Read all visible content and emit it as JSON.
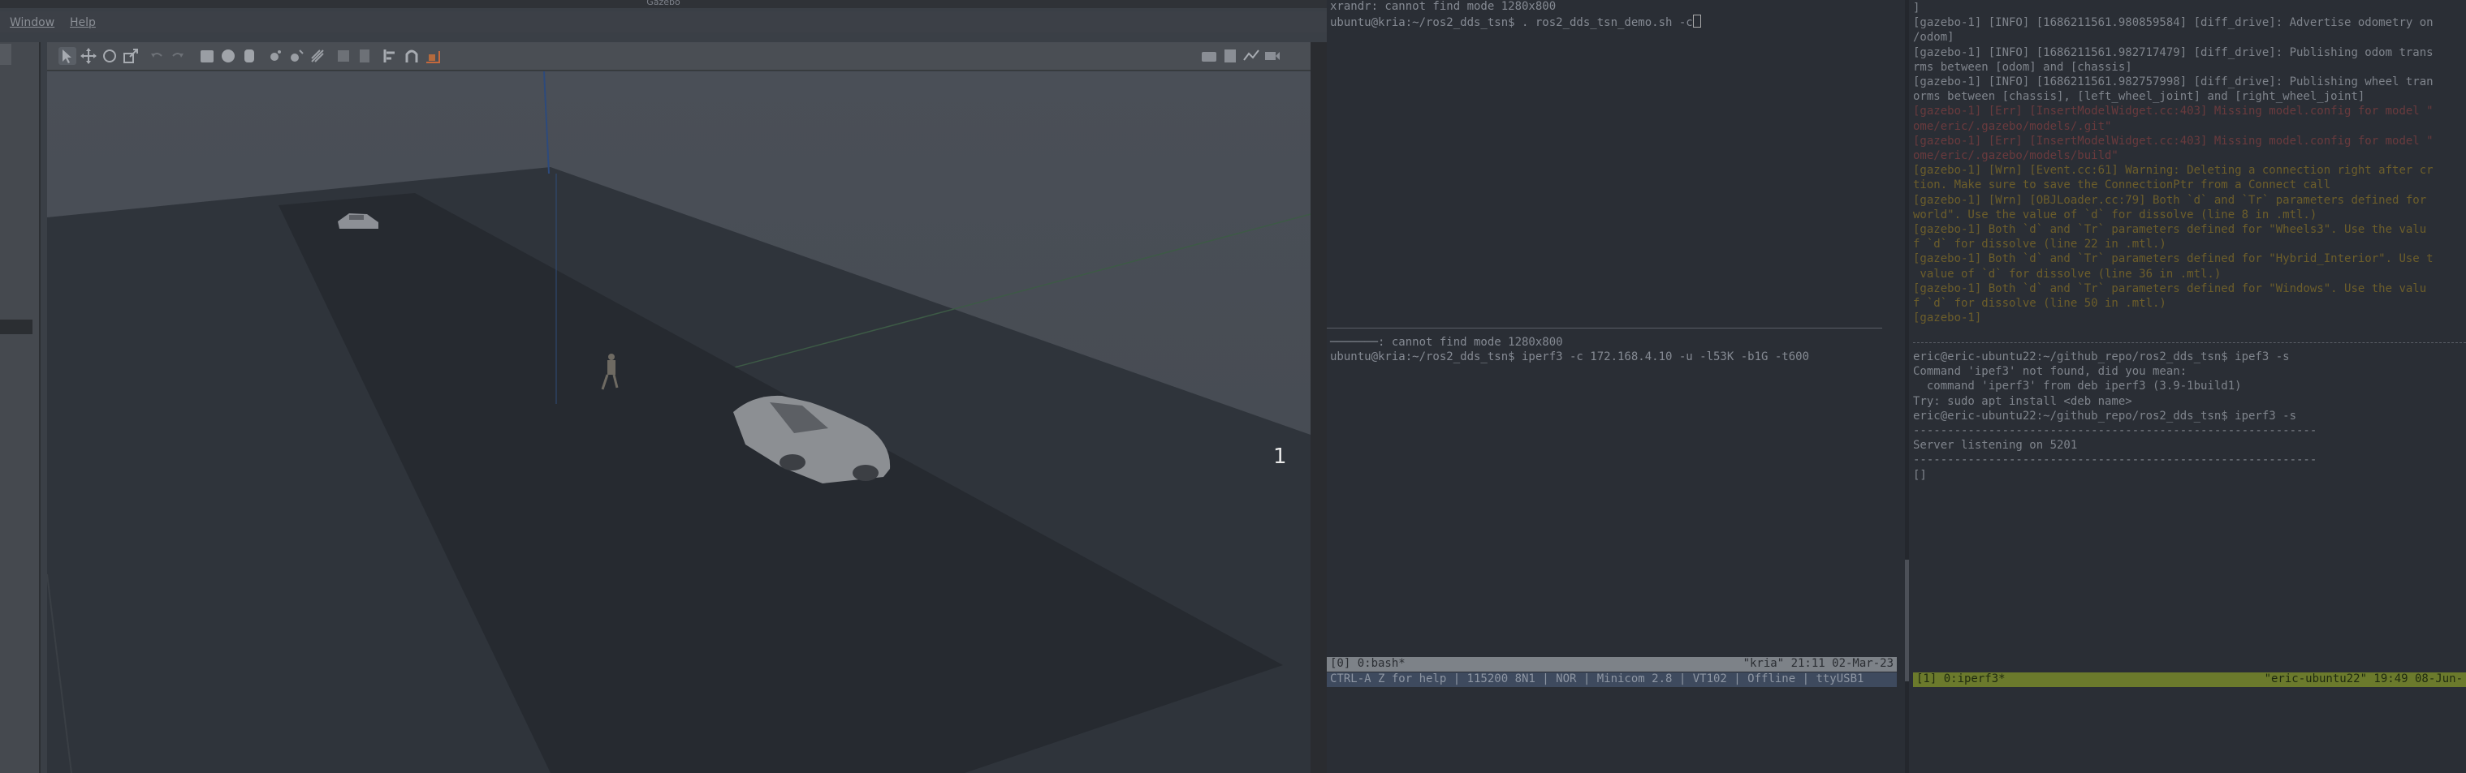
{
  "gazebo": {
    "title": "Gazebo",
    "menu": [
      "Window",
      "Help"
    ],
    "toolbar_icons": [
      "select-icon",
      "translate-icon",
      "rotate-icon",
      "scale-icon",
      "undo-icon",
      "redo-icon",
      "box-icon",
      "sphere-icon",
      "cylinder-icon",
      "point-light-icon",
      "spot-light-icon",
      "directional-light-icon",
      "copy-icon",
      "paste-icon",
      "align-icon",
      "snap-icon",
      "change-view-icon"
    ],
    "toolbar_right_icons": [
      "screenshot-icon",
      "log-icon",
      "plot-icon",
      "video-icon"
    ],
    "viewport_label": "1"
  },
  "term_mid": {
    "lines": [
      "xrandr: cannot find mode 1280x800",
      "ubuntu@kria:~/ros2_dds_tsn$ . ros2_dds_tsn_demo.sh -c"
    ],
    "lines_lower": [
      "───────: cannot find mode 1280x800",
      "ubuntu@kria:~/ros2_dds_tsn$ iperf3 -c 172.168.4.10 -u -l53K -b1G -t600"
    ],
    "status_left": "[0] 0:bash*",
    "status_right": "\"kria\" 21:11 02-Mar-23",
    "minicom_status": "CTRL-A Z for help | 115200 8N1 | NOR | Minicom 2.8 | VT102 | Offline | ttyUSB1"
  },
  "term_right": {
    "log_lines": [
      {
        "text": "]",
        "kind": "info"
      },
      {
        "text": "[gazebo-1] [INFO] [1686211561.980859584] [diff_drive]: Advertise odometry on",
        "kind": "info"
      },
      {
        "text": "/odom]",
        "kind": "info"
      },
      {
        "text": "[gazebo-1] [INFO] [1686211561.982717479] [diff_drive]: Publishing odom trans",
        "kind": "info"
      },
      {
        "text": "rms between [odom] and [chassis]",
        "kind": "info"
      },
      {
        "text": "[gazebo-1] [INFO] [1686211561.982757998] [diff_drive]: Publishing wheel tran",
        "kind": "info"
      },
      {
        "text": "orms between [chassis], [left_wheel_joint] and [right_wheel_joint]",
        "kind": "info"
      },
      {
        "text": "[gazebo-1] [Err] [InsertModelWidget.cc:403] Missing model.config for model \"",
        "kind": "err"
      },
      {
        "text": "ome/eric/.gazebo/models/.git\"",
        "kind": "err"
      },
      {
        "text": "[gazebo-1] [Err] [InsertModelWidget.cc:403] Missing model.config for model \"",
        "kind": "err"
      },
      {
        "text": "ome/eric/.gazebo/models/build\"",
        "kind": "err"
      },
      {
        "text": "[gazebo-1] [Wrn] [Event.cc:61] Warning: Deleting a connection right after cr",
        "kind": "warn"
      },
      {
        "text": "tion. Make sure to save the ConnectionPtr from a Connect call",
        "kind": "warn"
      },
      {
        "text": "[gazebo-1] [Wrn] [OBJLoader.cc:79] Both `d` and `Tr` parameters defined for",
        "kind": "warn"
      },
      {
        "text": "world\". Use the value of `d` for dissolve (line 8 in .mtl.)",
        "kind": "warn"
      },
      {
        "text": "[gazebo-1] Both `d` and `Tr` parameters defined for \"Wheels3\". Use the valu",
        "kind": "warn"
      },
      {
        "text": "f `d` for dissolve (line 22 in .mtl.)",
        "kind": "warn"
      },
      {
        "text": "[gazebo-1] Both `d` and `Tr` parameters defined for \"Hybrid_Interior\". Use t",
        "kind": "warn"
      },
      {
        "text": " value of `d` for dissolve (line 36 in .mtl.)",
        "kind": "warn"
      },
      {
        "text": "[gazebo-1] Both `d` and `Tr` parameters defined for \"Windows\". Use the valu",
        "kind": "warn"
      },
      {
        "text": "f `d` for dissolve (line 50 in .mtl.)",
        "kind": "warn"
      },
      {
        "text": "[gazebo-1]",
        "kind": "warn"
      }
    ],
    "iperf_lines": [
      "eric@eric-ubuntu22:~/github_repo/ros2_dds_tsn$ ipef3 -s",
      "Command 'ipef3' not found, did you mean:",
      "  command 'iperf3' from deb iperf3 (3.9-1build1)",
      "Try: sudo apt install <deb name>",
      "eric@eric-ubuntu22:~/github_repo/ros2_dds_tsn$ iperf3 -s",
      "-----------------------------------------------------------",
      "Server listening on 5201",
      "-----------------------------------------------------------",
      "[]"
    ],
    "status_left": "[1] 0:iperf3*",
    "status_right": "\"eric-ubuntu22\" 19:49 08-Jun-"
  }
}
